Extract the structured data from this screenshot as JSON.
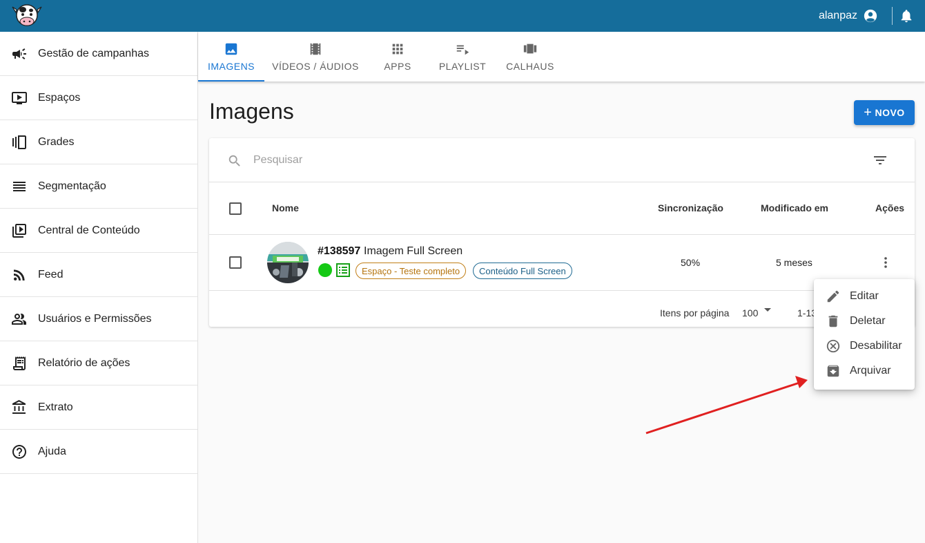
{
  "header": {
    "username": "alanpaz",
    "brand_color": "#156d9b"
  },
  "sidebar": {
    "items": [
      {
        "label": "Gestão de campanhas",
        "icon": "megaphone-icon"
      },
      {
        "label": "Espaços",
        "icon": "monitor-play-icon"
      },
      {
        "label": "Grades",
        "icon": "carousel-icon"
      },
      {
        "label": "Segmentação",
        "icon": "list-lines-icon"
      },
      {
        "label": "Central de Conteúdo",
        "icon": "video-library-icon"
      },
      {
        "label": "Feed",
        "icon": "rss-icon"
      },
      {
        "label": "Usuários e Permissões",
        "icon": "people-icon"
      },
      {
        "label": "Relatório de ações",
        "icon": "receipt-icon"
      },
      {
        "label": "Extrato",
        "icon": "bank-icon"
      },
      {
        "label": "Ajuda",
        "icon": "help-icon"
      }
    ]
  },
  "tabs": [
    {
      "label": "IMAGENS",
      "icon": "image-icon",
      "active": true
    },
    {
      "label": "VÍDEOS / ÁUDIOS",
      "icon": "film-icon",
      "active": false
    },
    {
      "label": "APPS",
      "icon": "apps-grid-icon",
      "active": false
    },
    {
      "label": "PLAYLIST",
      "icon": "playlist-icon",
      "active": false
    },
    {
      "label": "CALHAUS",
      "icon": "view-carousel-icon",
      "active": false
    }
  ],
  "page": {
    "title": "Imagens",
    "new_button": "NOVO"
  },
  "search": {
    "placeholder": "Pesquisar",
    "value": ""
  },
  "table": {
    "columns": {
      "name": "Nome",
      "sync": "Sincronização",
      "modified": "Modificado em",
      "actions": "Ações"
    },
    "rows": [
      {
        "id": "#138597",
        "name": "Imagem Full Screen",
        "status_color": "#15c915",
        "chips": [
          "Espaço - Teste completo",
          "Conteúdo Full Screen"
        ],
        "sync": "50%",
        "modified": "5 meses"
      }
    ],
    "footer": {
      "per_page_label": "Itens por página",
      "per_page_value": "100",
      "range": "1-13"
    }
  },
  "menu": {
    "items": [
      {
        "label": "Editar",
        "icon": "pencil-icon"
      },
      {
        "label": "Deletar",
        "icon": "trash-icon"
      },
      {
        "label": "Desabilitar",
        "icon": "cancel-circle-icon"
      },
      {
        "label": "Arquivar",
        "icon": "archive-icon"
      }
    ]
  },
  "annotation": {
    "arrow_color": "#e02020"
  }
}
